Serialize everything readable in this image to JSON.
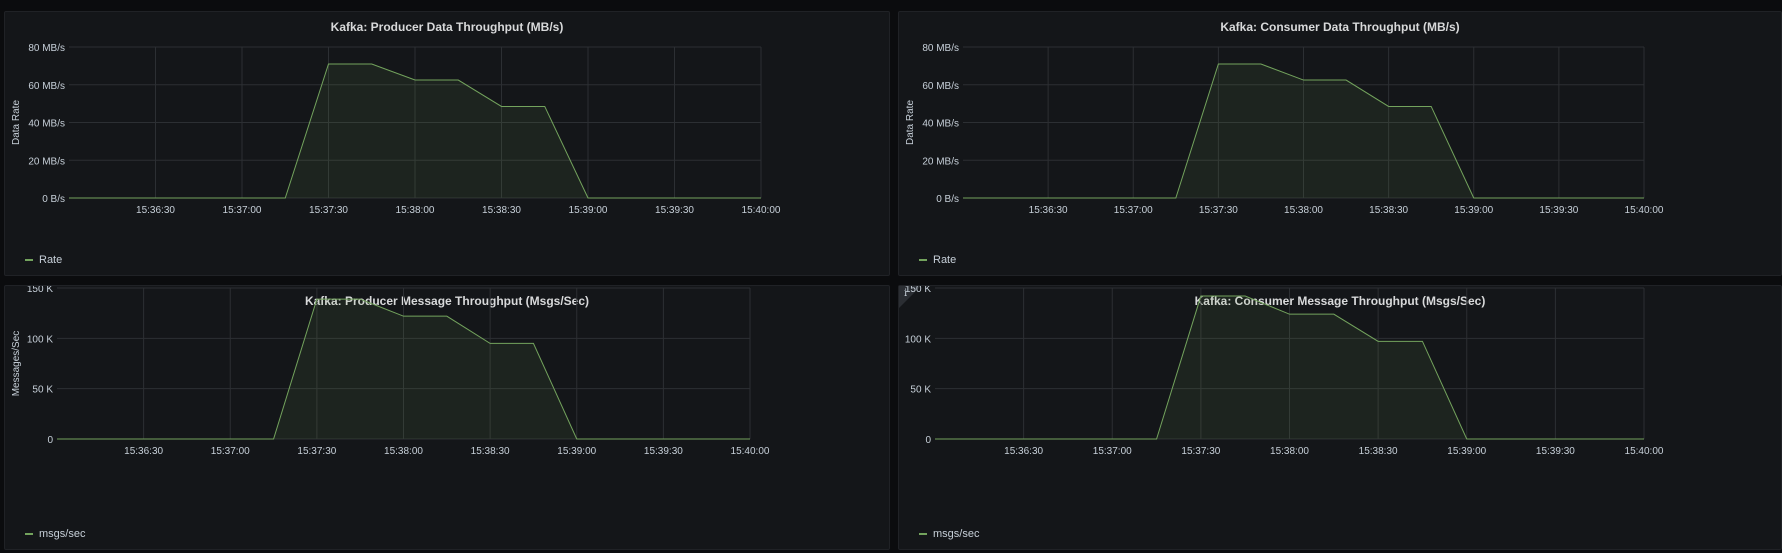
{
  "colors": {
    "series": "#73a35d",
    "grid": "#2c2f33",
    "panel_bg": "#141619",
    "page_bg": "#0b0c0e"
  },
  "panels": [
    {
      "title": "Kafka: Producer Data Throughput (MB/s)",
      "ylabel": "Data Rate",
      "legend": "Rate",
      "has_info": false
    },
    {
      "title": "Kafka: Consumer Data Throughput (MB/s)",
      "ylabel": "Data Rate",
      "legend": "Rate",
      "has_info": false
    },
    {
      "title": "Kafka: Producer Message Throughput (Msgs/Sec)",
      "ylabel": "Messages/Sec",
      "legend": "msgs/sec",
      "has_info": false
    },
    {
      "title": "Kafka: Consumer Message Throughput (Msgs/Sec)",
      "ylabel": "",
      "legend": "msgs/sec",
      "has_info": true,
      "info_glyph": "i"
    }
  ],
  "chart_data": [
    {
      "type": "area",
      "title": "Kafka: Producer Data Throughput (MB/s)",
      "ylabel": "Data Rate",
      "xlim": [
        "15:36:00",
        "15:40:00"
      ],
      "ylim": [
        0,
        80
      ],
      "x_ticks": [
        "15:36:30",
        "15:37:00",
        "15:37:30",
        "15:38:00",
        "15:38:30",
        "15:39:00",
        "15:39:30",
        "15:40:00"
      ],
      "y_ticks": [
        {
          "v": 0,
          "label": "0 B/s"
        },
        {
          "v": 20,
          "label": "20 MB/s"
        },
        {
          "v": 40,
          "label": "40 MB/s"
        },
        {
          "v": 60,
          "label": "60 MB/s"
        },
        {
          "v": 80,
          "label": "80 MB/s"
        }
      ],
      "grid": true,
      "legend": "bottom-left",
      "series": [
        {
          "name": "Rate",
          "x": [
            "15:36:00",
            "15:37:15",
            "15:37:30",
            "15:37:45",
            "15:38:00",
            "15:38:15",
            "15:38:30",
            "15:38:45",
            "15:39:00",
            "15:40:00"
          ],
          "y": [
            0,
            0,
            71,
            71,
            62.5,
            62.5,
            48.5,
            48.5,
            0,
            0
          ]
        }
      ]
    },
    {
      "type": "area",
      "title": "Kafka: Consumer Data Throughput (MB/s)",
      "ylabel": "Data Rate",
      "xlim": [
        "15:36:00",
        "15:40:00"
      ],
      "ylim": [
        0,
        80
      ],
      "x_ticks": [
        "15:36:30",
        "15:37:00",
        "15:37:30",
        "15:38:00",
        "15:38:30",
        "15:39:00",
        "15:39:30",
        "15:40:00"
      ],
      "y_ticks": [
        {
          "v": 0,
          "label": "0 B/s"
        },
        {
          "v": 20,
          "label": "20 MB/s"
        },
        {
          "v": 40,
          "label": "40 MB/s"
        },
        {
          "v": 60,
          "label": "60 MB/s"
        },
        {
          "v": 80,
          "label": "80 MB/s"
        }
      ],
      "grid": true,
      "legend": "bottom-left",
      "series": [
        {
          "name": "Rate",
          "x": [
            "15:36:00",
            "15:37:15",
            "15:37:30",
            "15:37:45",
            "15:38:00",
            "15:38:15",
            "15:38:30",
            "15:38:45",
            "15:39:00",
            "15:40:00"
          ],
          "y": [
            0,
            0,
            71,
            71,
            62.5,
            62.5,
            48.5,
            48.5,
            0,
            0
          ]
        }
      ]
    },
    {
      "type": "area",
      "title": "Kafka: Producer Message Throughput (Msgs/Sec)",
      "ylabel": "Messages/Sec",
      "xlim": [
        "15:36:00",
        "15:40:00"
      ],
      "ylim": [
        0,
        150000
      ],
      "x_ticks": [
        "15:36:30",
        "15:37:00",
        "15:37:30",
        "15:38:00",
        "15:38:30",
        "15:39:00",
        "15:39:30",
        "15:40:00"
      ],
      "y_ticks": [
        {
          "v": 0,
          "label": "0"
        },
        {
          "v": 50000,
          "label": "50 K"
        },
        {
          "v": 100000,
          "label": "100 K"
        },
        {
          "v": 150000,
          "label": "150 K"
        }
      ],
      "grid": true,
      "legend": "bottom-left",
      "series": [
        {
          "name": "msgs/sec",
          "x": [
            "15:36:00",
            "15:37:15",
            "15:37:30",
            "15:37:45",
            "15:38:00",
            "15:38:15",
            "15:38:30",
            "15:38:45",
            "15:39:00",
            "15:40:00"
          ],
          "y": [
            0,
            0,
            139000,
            139000,
            122000,
            122000,
            95000,
            95000,
            0,
            0
          ]
        }
      ]
    },
    {
      "type": "area",
      "title": "Kafka: Consumer Message Throughput (Msgs/Sec)",
      "ylabel": "",
      "xlim": [
        "15:36:00",
        "15:40:00"
      ],
      "ylim": [
        0,
        150000
      ],
      "x_ticks": [
        "15:36:30",
        "15:37:00",
        "15:37:30",
        "15:38:00",
        "15:38:30",
        "15:39:00",
        "15:39:30",
        "15:40:00"
      ],
      "y_ticks": [
        {
          "v": 0,
          "label": "0"
        },
        {
          "v": 50000,
          "label": "50 K"
        },
        {
          "v": 100000,
          "label": "100 K"
        },
        {
          "v": 150000,
          "label": "150 K"
        }
      ],
      "grid": true,
      "legend": "bottom-left",
      "series": [
        {
          "name": "msgs/sec",
          "x": [
            "15:36:00",
            "15:37:15",
            "15:37:30",
            "15:37:45",
            "15:38:00",
            "15:38:15",
            "15:38:30",
            "15:38:45",
            "15:39:00",
            "15:40:00"
          ],
          "y": [
            0,
            0,
            142000,
            142000,
            124000,
            124000,
            97000,
            97000,
            0,
            0
          ]
        }
      ]
    }
  ]
}
